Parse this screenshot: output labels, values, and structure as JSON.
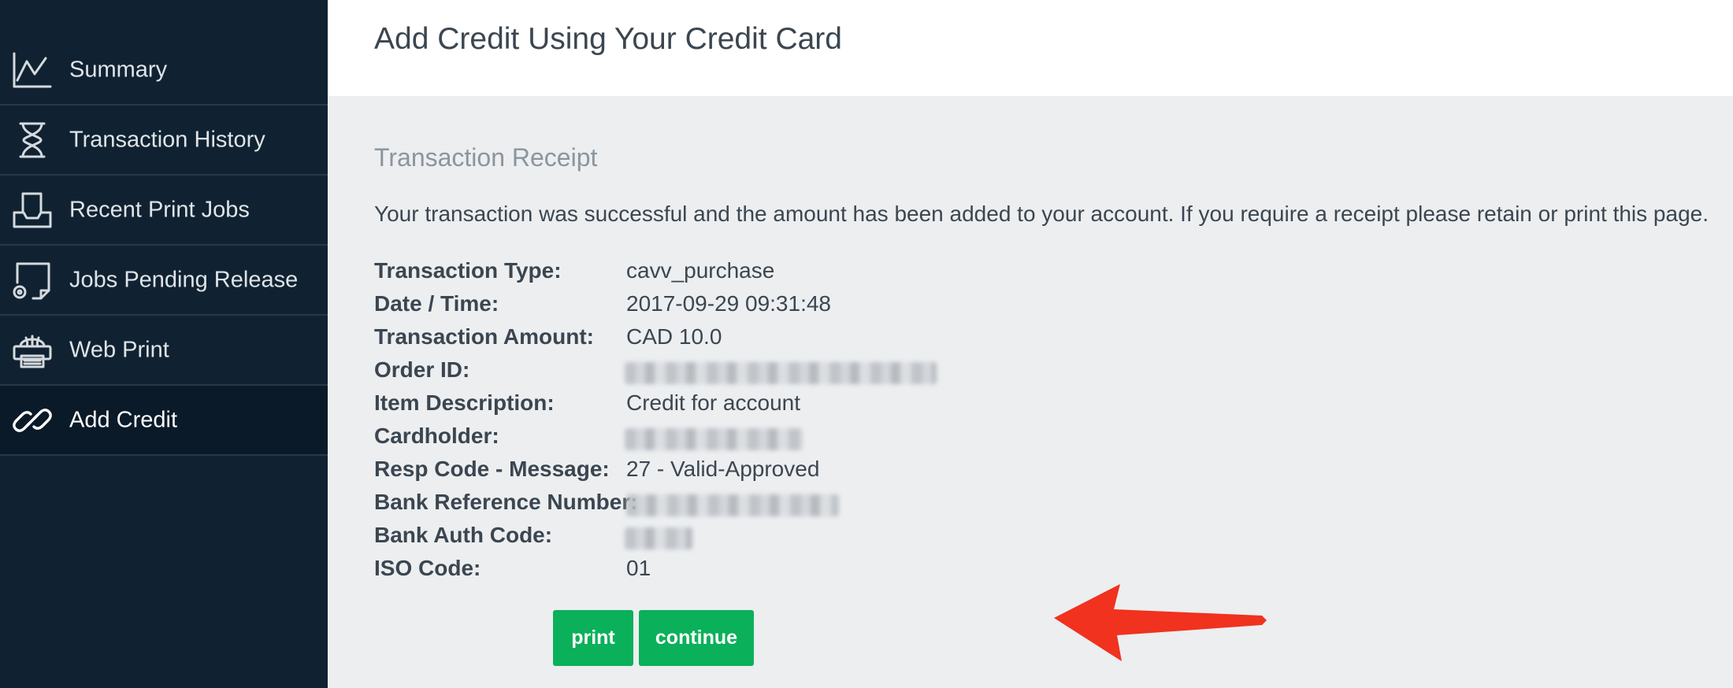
{
  "sidebar": {
    "items": [
      {
        "label": "Summary",
        "icon": "chart-line-icon",
        "active": false
      },
      {
        "label": "Transaction History",
        "icon": "hourglass-icon",
        "active": false
      },
      {
        "label": "Recent Print Jobs",
        "icon": "tray-icon",
        "active": false
      },
      {
        "label": "Jobs Pending Release",
        "icon": "document-pending-icon",
        "active": false
      },
      {
        "label": "Web Print",
        "icon": "printer-globe-icon",
        "active": false
      },
      {
        "label": "Add Credit",
        "icon": "link-icon",
        "active": true
      }
    ]
  },
  "main": {
    "title": "Add Credit Using Your Credit Card",
    "receipt": {
      "heading": "Transaction Receipt",
      "message": "Your transaction was successful and the amount has been added to your account. If you require a receipt please retain or print this page.",
      "fields": [
        {
          "label": "Transaction Type:",
          "value": "cavv_purchase"
        },
        {
          "label": "Date / Time:",
          "value": "2017-09-29 09:31:48"
        },
        {
          "label": "Transaction Amount:",
          "value": "CAD 10.0"
        },
        {
          "label": "Order ID:",
          "value": null,
          "redacted": true
        },
        {
          "label": "Item Description:",
          "value": "Credit for account"
        },
        {
          "label": "Cardholder:",
          "value": null,
          "redacted": true
        },
        {
          "label": "Resp Code - Message:",
          "value": "27 - Valid-Approved"
        },
        {
          "label": "Bank Reference Number:",
          "value": null,
          "redacted": true
        },
        {
          "label": "Bank Auth Code:",
          "value": null,
          "redacted": true
        },
        {
          "label": "ISO Code:",
          "value": "01"
        }
      ]
    },
    "buttons": {
      "print": "print",
      "continue": "continue"
    }
  },
  "colors": {
    "sidebar_bg": "#102232",
    "accent_green": "#0bb05a",
    "annotation_arrow": "#f0321e"
  }
}
